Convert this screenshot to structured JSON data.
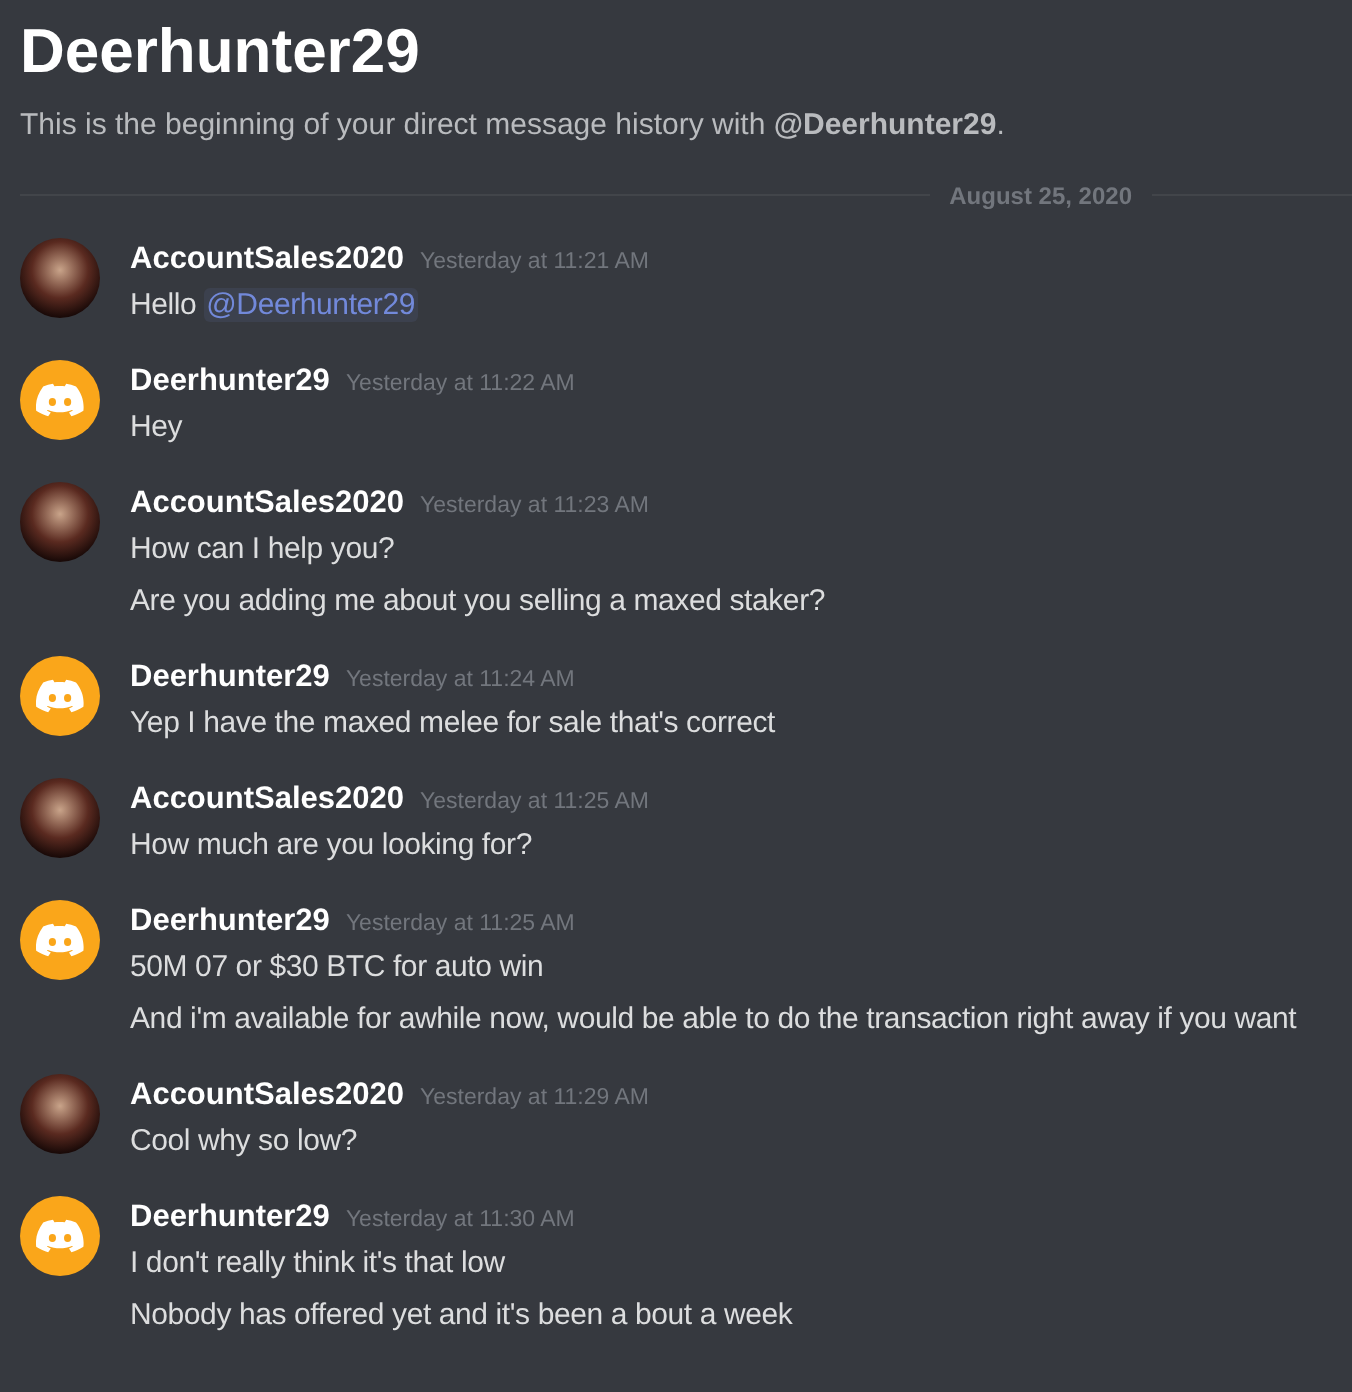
{
  "header": {
    "title": "Deerhunter29",
    "intro": "This is the beginning of your direct message history with **@Deerhunter29**."
  },
  "date_divider": "August 25, 2020",
  "messages": [
    {
      "author": "AccountSales2020",
      "avatar": {
        "kind": "photo"
      },
      "time": "Yesterday at 11:21 AM",
      "lines": [
        {
          "text": "Hello",
          "mention": "@Deerhunter29"
        }
      ]
    },
    {
      "author": "Deerhunter29",
      "avatar": {
        "kind": "default",
        "color": "#faa61a"
      },
      "time": "Yesterday at 11:22 AM",
      "lines": [
        {
          "text": "Hey"
        }
      ]
    },
    {
      "author": "AccountSales2020",
      "avatar": {
        "kind": "photo"
      },
      "time": "Yesterday at 11:23 AM",
      "lines": [
        {
          "text": "How can I help you?"
        },
        {
          "text": "Are you adding me about you selling a maxed staker?"
        }
      ]
    },
    {
      "author": "Deerhunter29",
      "avatar": {
        "kind": "default",
        "color": "#faa61a"
      },
      "time": "Yesterday at 11:24 AM",
      "lines": [
        {
          "text": "Yep I have the maxed melee for sale that's correct"
        }
      ]
    },
    {
      "author": "AccountSales2020",
      "avatar": {
        "kind": "photo"
      },
      "time": "Yesterday at 11:25 AM",
      "lines": [
        {
          "text": "How much are you looking for?"
        }
      ]
    },
    {
      "author": "Deerhunter29",
      "avatar": {
        "kind": "default",
        "color": "#faa61a"
      },
      "time": "Yesterday at 11:25 AM",
      "lines": [
        {
          "text": "50M 07 or $30 BTC for auto win"
        },
        {
          "text": "And i'm available for awhile now, would be able to do the transaction right away if you want"
        }
      ]
    },
    {
      "author": "AccountSales2020",
      "avatar": {
        "kind": "photo"
      },
      "time": "Yesterday at 11:29 AM",
      "lines": [
        {
          "text": "Cool why so low?"
        }
      ]
    },
    {
      "author": "Deerhunter29",
      "avatar": {
        "kind": "default",
        "color": "#faa61a"
      },
      "time": "Yesterday at 11:30 AM",
      "lines": [
        {
          "text": "I don't really think it's that low"
        },
        {
          "text": "Nobody has offered yet and it's been a bout a week"
        }
      ]
    }
  ]
}
